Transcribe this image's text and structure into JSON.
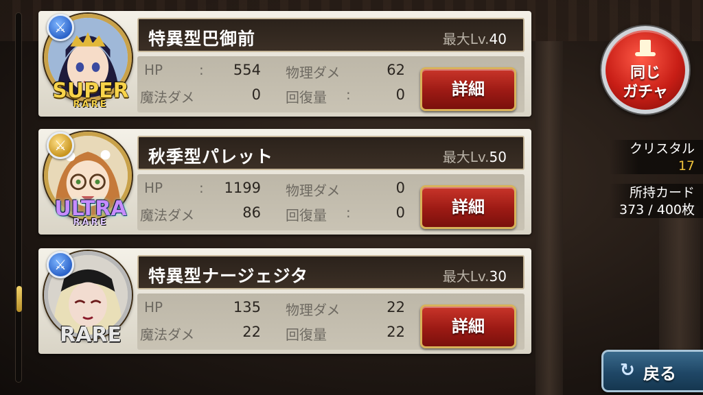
{
  "cards": [
    {
      "name": "特異型巴御前",
      "max_lv_label": "最大Lv.",
      "max_lv": "40",
      "rarity_big": "SUPER",
      "rarity_small": "RARE",
      "stats": {
        "hp_label": "HP",
        "hp": "554",
        "phys_label": "物理ダメ",
        "phys": "62",
        "magic_label": "魔法ダメ",
        "magic": "0",
        "heal_label": "回復量",
        "heal": "0"
      },
      "detail_label": "詳細"
    },
    {
      "name": "秋季型パレット",
      "max_lv_label": "最大Lv.",
      "max_lv": "50",
      "rarity_big": "ULTRA",
      "rarity_small": "RARE",
      "stats": {
        "hp_label": "HP",
        "hp": "1199",
        "phys_label": "物理ダメ",
        "phys": "0",
        "magic_label": "魔法ダメ",
        "magic": "86",
        "heal_label": "回復量",
        "heal": "0"
      },
      "detail_label": "詳細"
    },
    {
      "name": "特異型ナージェジタ",
      "max_lv_label": "最大Lv.",
      "max_lv": "30",
      "rarity_big": "RARE",
      "rarity_small": "",
      "stats": {
        "hp_label": "HP",
        "hp": "135",
        "phys_label": "物理ダメ",
        "phys": "22",
        "magic_label": "魔法ダメ",
        "magic": "22",
        "heal_label": "回復量",
        "heal": "22"
      },
      "detail_label": "詳細"
    }
  ],
  "colon": ":",
  "gacha_button": {
    "line1": "同じ",
    "line2": "ガチャ"
  },
  "crystal": {
    "label": "クリスタル",
    "value": "17"
  },
  "owned_cards": {
    "label": "所持カード",
    "value": "373 / 400枚"
  },
  "back_button": {
    "label": "戻る",
    "icon": "return-arrow-icon"
  },
  "colors": {
    "detail_button": "#9c1a14",
    "gacha_button": "#c81e16",
    "crystal_value": "#f0c33c",
    "back_button": "#1f4766"
  }
}
